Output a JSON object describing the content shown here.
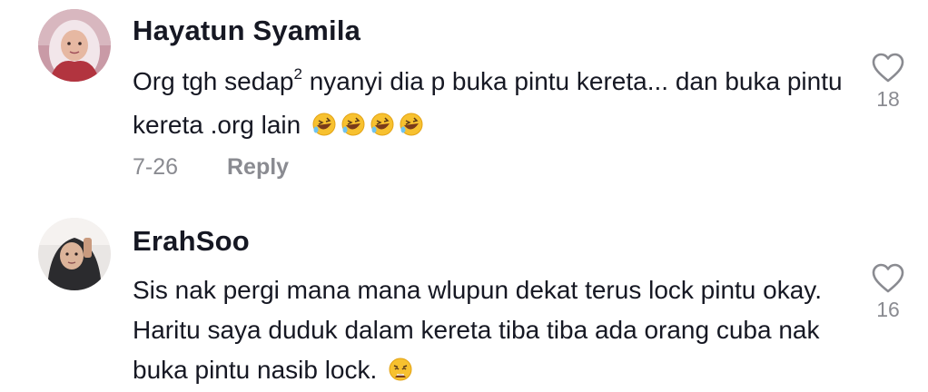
{
  "comments": [
    {
      "username": "Hayatun Syamila",
      "text_before_sup": "Org tgh sedap",
      "sup": "2",
      "text_after_sup": " nyanyi dia p buka pintu kereta... dan buka pintu kereta .org lain ",
      "emojis": [
        "rolling-on-floor-laughing",
        "rolling-on-floor-laughing",
        "rolling-on-floor-laughing",
        "rolling-on-floor-laughing"
      ],
      "date": "7-26",
      "reply_label": "Reply",
      "like_count": "18",
      "icon": "heart-outline-icon"
    },
    {
      "username": "ErahSoo",
      "text": "Sis nak pergi mana mana wlupun dekat terus lock pintu okay. Haritu saya duduk dalam kereta tiba tiba ada orang cuba nak buka pintu nasib lock. ",
      "emojis": [
        "weary-face"
      ],
      "like_count": "16",
      "icon": "heart-outline-icon"
    }
  ],
  "colors": {
    "text": "#161823",
    "secondary": "#8a8b91",
    "background": "#ffffff",
    "emoji_yellow": "#f7c12f"
  }
}
